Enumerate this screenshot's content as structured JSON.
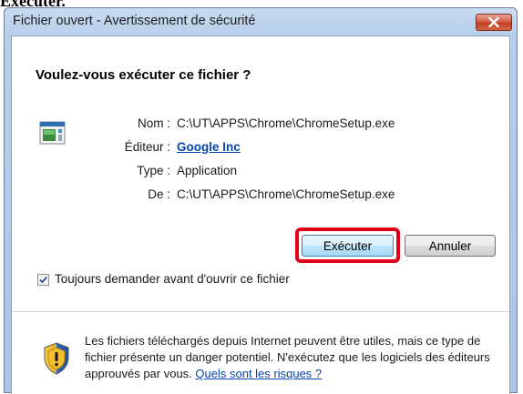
{
  "caption": "Exécuter.",
  "window": {
    "title": "Fichier ouvert - Avertissement de sécurité",
    "close_icon": "close-icon"
  },
  "heading": "Voulez-vous exécuter ce fichier ?",
  "details": [
    {
      "label": "Nom :",
      "value": "C:\\UT\\APPS\\Chrome\\ChromeSetup.exe"
    },
    {
      "label": "Éditeur :",
      "value": "Google Inc"
    },
    {
      "label": "Type :",
      "value": "Application"
    },
    {
      "label": "De :",
      "value": "C:\\UT\\APPS\\Chrome\\ChromeSetup.exe"
    }
  ],
  "buttons": {
    "run_label": "Exécuter",
    "cancel_label": "Annuler"
  },
  "checkbox": {
    "label": "Toujours demander avant d'ouvrir ce fichier",
    "checked": true
  },
  "warning": {
    "text": "Les fichiers téléchargés depuis Internet peuvent être utiles, mais ce type de fichier présente un danger potentiel. N'exécutez que les logiciels des éditeurs approuvés par vous. ",
    "link": "Quels sont les risques ?"
  },
  "colors": {
    "highlight": "#e0001a",
    "link": "#0645ad"
  }
}
